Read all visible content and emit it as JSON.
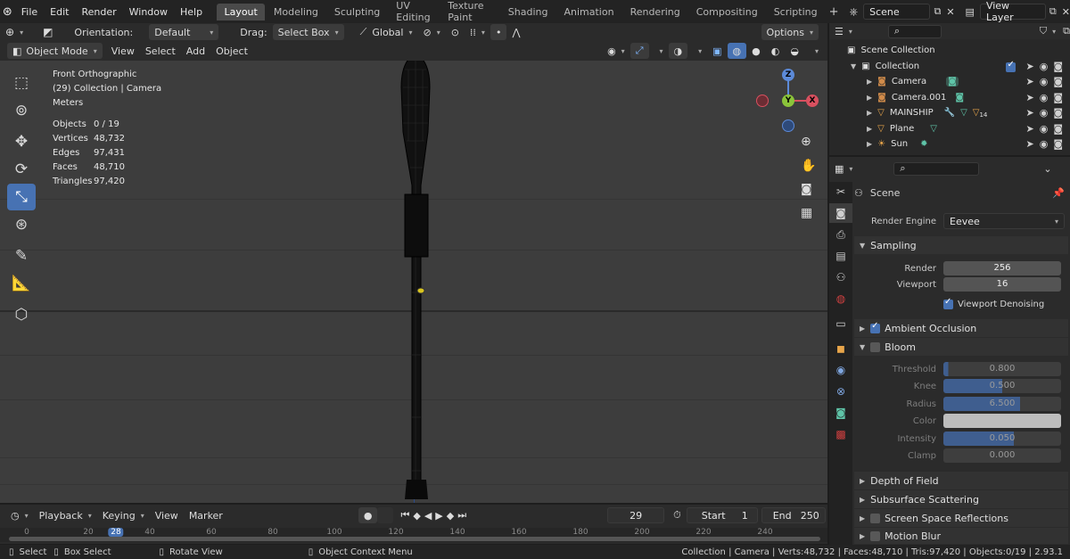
{
  "topbar": {
    "menus": [
      "File",
      "Edit",
      "Render",
      "Window",
      "Help"
    ],
    "workspaces": [
      "Layout",
      "Modeling",
      "Sculpting",
      "UV Editing",
      "Texture Paint",
      "Shading",
      "Animation",
      "Rendering",
      "Compositing",
      "Scripting"
    ],
    "active_workspace": "Layout",
    "scene": "Scene",
    "view_layer": "View Layer"
  },
  "viewport_header": {
    "orientation_label": "Orientation:",
    "orientation_value": "Default",
    "drag_label": "Drag:",
    "drag_value": "Select Box",
    "transform_value": "Global",
    "options_label": "Options",
    "mode": "Object Mode",
    "menus": [
      "View",
      "Select",
      "Add",
      "Object"
    ]
  },
  "overlay": {
    "view_name": "Front Orthographic",
    "context": "(29) Collection | Camera",
    "units": "Meters",
    "stats": [
      {
        "label": "Objects",
        "value": "0 / 19"
      },
      {
        "label": "Vertices",
        "value": "48,732"
      },
      {
        "label": "Edges",
        "value": "97,431"
      },
      {
        "label": "Faces",
        "value": "48,710"
      },
      {
        "label": "Triangles",
        "value": "97,420"
      }
    ]
  },
  "gizmo": {
    "z": "Z",
    "y": "Y",
    "x": "X"
  },
  "timeline": {
    "menus": [
      "Playback",
      "Keying",
      "View",
      "Marker"
    ],
    "current_frame": "29",
    "start_label": "Start",
    "start": "1",
    "end_label": "End",
    "end": "250",
    "ruler": [
      "0",
      "20",
      "28",
      "40",
      "60",
      "80",
      "100",
      "120",
      "140",
      "160",
      "180",
      "200",
      "220",
      "240"
    ]
  },
  "statusbar": {
    "select": "Select",
    "box_select": "Box Select",
    "rotate_view": "Rotate View",
    "context_menu": "Object Context Menu",
    "info": "Collection | Camera | Verts:48,732 | Faces:48,710 | Tris:97,420 | Objects:0/19 | 2.93.1"
  },
  "outliner": {
    "root": "Scene Collection",
    "collection": "Collection",
    "items": [
      {
        "name": "Camera",
        "color": "#d08b4a"
      },
      {
        "name": "Camera.001",
        "color": "#d08b4a"
      },
      {
        "name": "MAINSHIP",
        "color": "#e8a54a"
      },
      {
        "name": "Plane",
        "color": "#e8a54a"
      },
      {
        "name": "Sun",
        "color": "#e8a54a"
      }
    ],
    "mainship_badge": "14"
  },
  "properties": {
    "context": "Scene",
    "render_engine_label": "Render Engine",
    "render_engine": "Eevee",
    "sampling": {
      "title": "Sampling",
      "render_label": "Render",
      "render": "256",
      "viewport_label": "Viewport",
      "viewport": "16",
      "denoise_label": "Viewport Denoising"
    },
    "ambient_occlusion": "Ambient Occlusion",
    "bloom": {
      "title": "Bloom",
      "threshold_label": "Threshold",
      "threshold": "0.800",
      "threshold_fill": 0.04,
      "knee_label": "Knee",
      "knee": "0.500",
      "knee_fill": 0.5,
      "radius_label": "Radius",
      "radius": "6.500",
      "radius_fill": 0.65,
      "color_label": "Color",
      "intensity_label": "Intensity",
      "intensity": "0.050",
      "intensity_fill": 0.6,
      "clamp_label": "Clamp",
      "clamp": "0.000"
    },
    "sections": [
      "Depth of Field",
      "Subsurface Scattering",
      "Screen Space Reflections",
      "Motion Blur"
    ]
  },
  "colors": {
    "accent": "#4772b3",
    "viewport_bg": "#3d3d3d"
  }
}
